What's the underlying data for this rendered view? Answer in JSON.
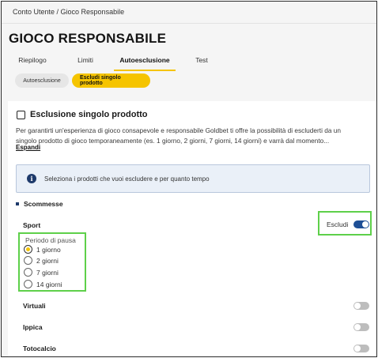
{
  "breadcrumb": "Conto Utente / Gioco Responsabile",
  "page_title": "GIOCO RESPONSABILE",
  "tabs": [
    {
      "label": "Riepilogo"
    },
    {
      "label": "Limiti"
    },
    {
      "label": "Autoesclusione"
    },
    {
      "label": "Test"
    }
  ],
  "subtabs": {
    "autoesclusione": "Autoesclusione",
    "escludi_singolo": "Escludi singolo prodotto"
  },
  "section": {
    "title": "Esclusione singolo prodotto",
    "desc_line1": "Per garantirti un'esperienza di gioco consapevole e responsabile Goldbet ti offre la possibilità di escluderti da un",
    "desc_line2": "singolo prodotto di gioco temporaneamente (es. 1 giorno, 2 giorni, 7 giorni, 14 giorni) e varrà dal momento...",
    "expand": "Espandi"
  },
  "info": {
    "text": "Seleziona i prodotti che vuoi escludere e per quanto tempo",
    "icon": "info-icon"
  },
  "category": "Scommesse",
  "sport": {
    "label": "Sport",
    "exclude_label": "Escludi",
    "pause_label": "Periodo di pausa",
    "options": [
      "1 giorno",
      "2 giorni",
      "7 giorni",
      "14 giorni"
    ],
    "selected": "1 giorno"
  },
  "other_products": [
    {
      "label": "Virtuali"
    },
    {
      "label": "Ippica"
    },
    {
      "label": "Totocalcio"
    }
  ],
  "colors": {
    "accent_yellow": "#f5c400",
    "toggle_on": "#1e4f96",
    "highlight_green": "#5ed04a",
    "info_bg": "#eaf0f8"
  }
}
